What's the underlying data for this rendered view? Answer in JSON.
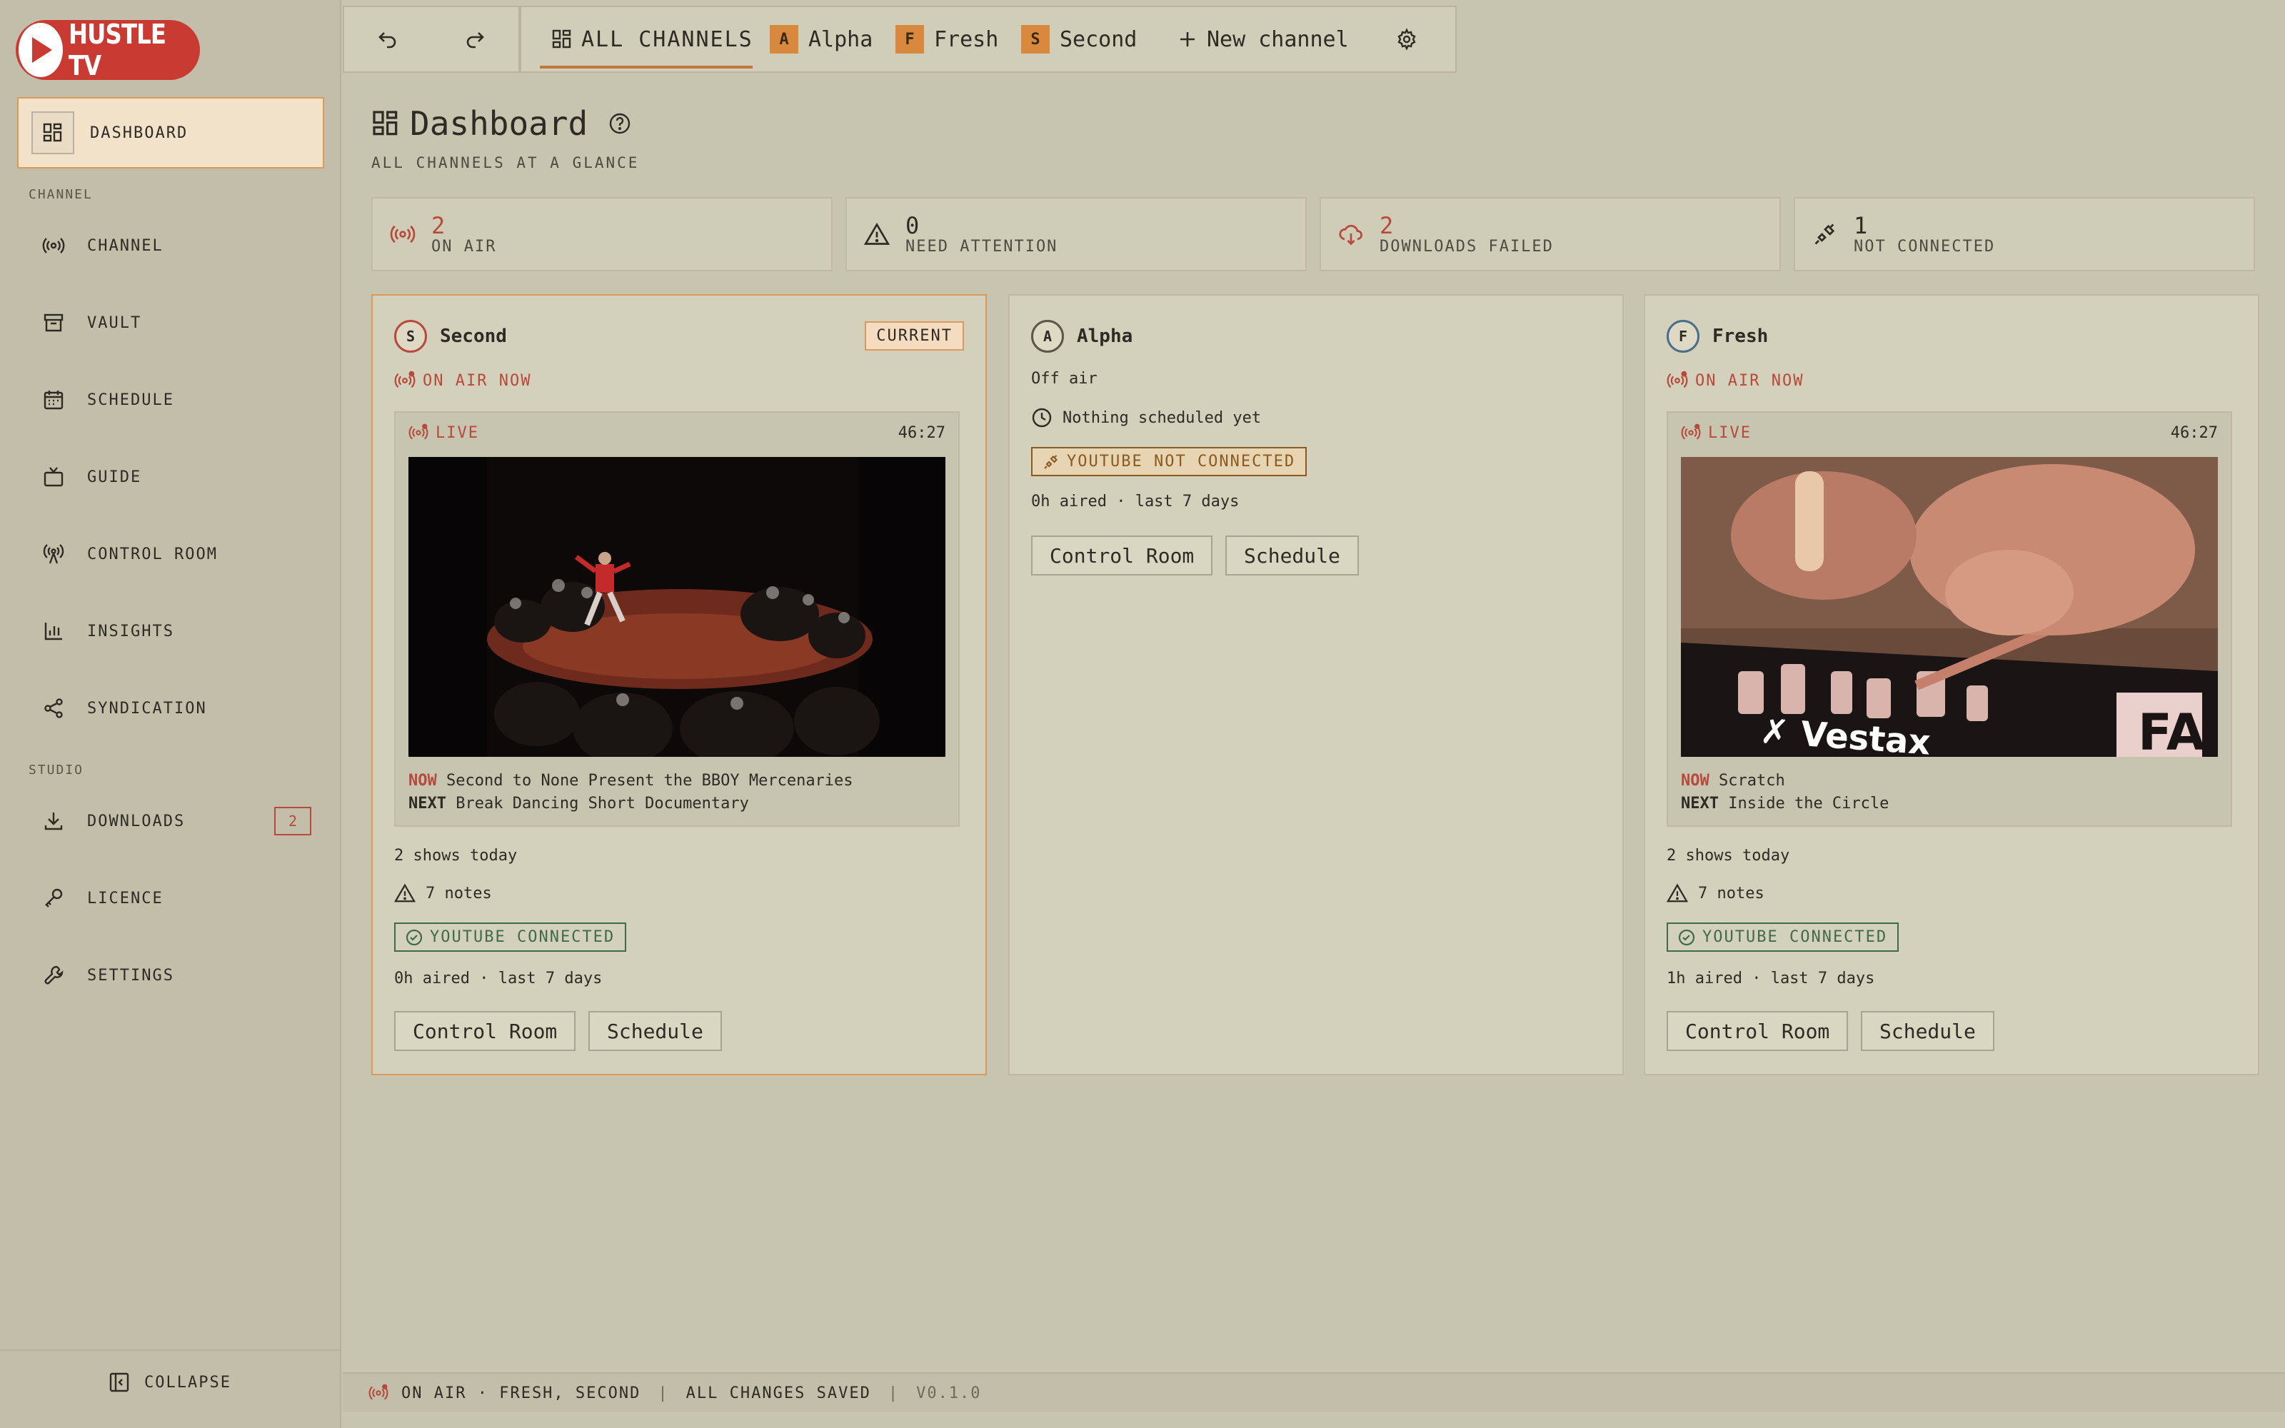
{
  "brand": {
    "name": "HUSTLE TV"
  },
  "sidebar": {
    "active": "DASHBOARD",
    "sections": {
      "channel": "CHANNEL",
      "studio": "STUDIO"
    },
    "items": [
      {
        "label": "CHANNEL",
        "icon": "broadcast-icon"
      },
      {
        "label": "VAULT",
        "icon": "archive-icon"
      },
      {
        "label": "SCHEDULE",
        "icon": "calendar-icon"
      },
      {
        "label": "GUIDE",
        "icon": "tv-icon"
      },
      {
        "label": "CONTROL ROOM",
        "icon": "antenna-icon"
      },
      {
        "label": "INSIGHTS",
        "icon": "bar-chart-icon"
      },
      {
        "label": "SYNDICATION",
        "icon": "share-icon"
      },
      {
        "label": "DOWNLOADS",
        "icon": "download-icon",
        "badge": "2"
      },
      {
        "label": "LICENCE",
        "icon": "key-icon"
      },
      {
        "label": "SETTINGS",
        "icon": "wrench-icon"
      }
    ],
    "collapse": "COLLAPSE"
  },
  "topbar": {
    "tabs": [
      {
        "label": "ALL CHANNELS",
        "active": true
      },
      {
        "label": "Alpha",
        "letter": "A"
      },
      {
        "label": "Fresh",
        "letter": "F"
      },
      {
        "label": "Second",
        "letter": "S"
      }
    ],
    "new_channel": "New channel"
  },
  "page": {
    "title": "Dashboard",
    "subtitle": "ALL CHANNELS AT A GLANCE"
  },
  "stats": [
    {
      "value": "2",
      "label": "ON AIR",
      "icon": "broadcast-icon",
      "color": "#b74a3c"
    },
    {
      "value": "0",
      "label": "NEED ATTENTION",
      "icon": "warning-icon",
      "color": "#2e2b25"
    },
    {
      "value": "2",
      "label": "DOWNLOADS FAILED",
      "icon": "cloud-download-icon",
      "color": "#b74a3c"
    },
    {
      "value": "1",
      "label": "NOT CONNECTED",
      "icon": "unplug-icon",
      "color": "#2e2b25"
    }
  ],
  "cards": [
    {
      "letter": "S",
      "name": "Second",
      "badge": "CURRENT",
      "status": "ON AIR NOW",
      "live": "LIVE",
      "time": "46:27",
      "now_tag": "NOW",
      "now": "Second to None Present the BBOY Mercenaries",
      "next_tag": "NEXT",
      "next": "Break Dancing Short Documentary",
      "shows": "2 shows today",
      "notes": "7 notes",
      "youtube": "YOUTUBE CONNECTED",
      "aired": "0h aired · last 7 days",
      "btn1": "Control Room",
      "btn2": "Schedule"
    },
    {
      "letter": "A",
      "name": "Alpha",
      "status": "Off air",
      "schedule": "Nothing scheduled yet",
      "youtube": "YOUTUBE NOT CONNECTED",
      "aired": "0h aired · last 7 days",
      "btn1": "Control Room",
      "btn2": "Schedule"
    },
    {
      "letter": "F",
      "name": "Fresh",
      "status": "ON AIR NOW",
      "live": "LIVE",
      "time": "46:27",
      "now_tag": "NOW",
      "now": "Scratch",
      "next_tag": "NEXT",
      "next": "Inside the Circle",
      "shows": "2 shows today",
      "notes": "7 notes",
      "youtube": "YOUTUBE CONNECTED",
      "aired": "1h aired · last 7 days",
      "btn1": "Control Room",
      "btn2": "Schedule"
    }
  ],
  "statusbar": {
    "onair": "ON AIR · FRESH, SECOND",
    "saved": "ALL CHANGES SAVED",
    "version": "V0.1.0",
    "sep": "|"
  },
  "colors": {
    "accent": "#d99a5c",
    "live_red": "#b74a3c",
    "brand_red": "#c93a33",
    "ok_green": "#3f6b4a"
  }
}
